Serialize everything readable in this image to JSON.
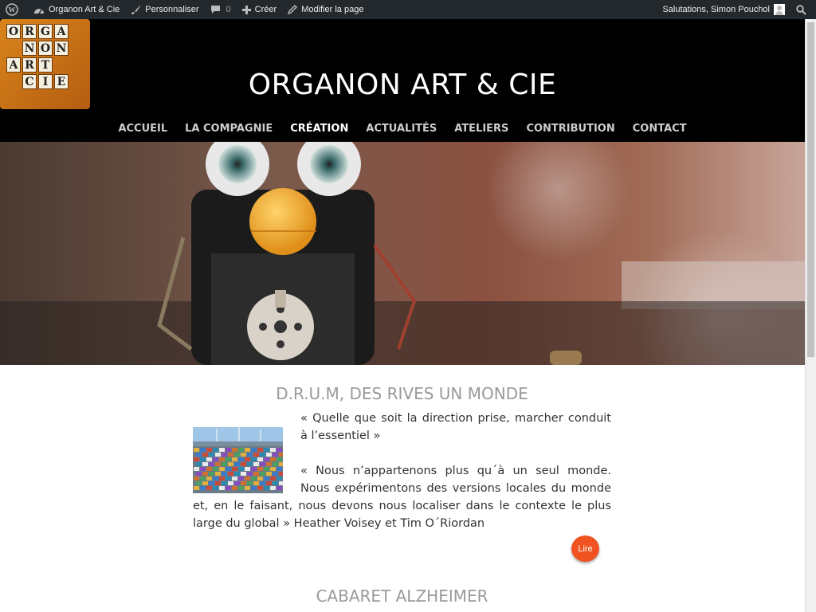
{
  "adminbar": {
    "site_name": "Organon Art & Cie",
    "customize": "Personnaliser",
    "comments_count": "0",
    "create": "Créer",
    "edit_page": "Modifier la page",
    "greeting": "Salutations, Simon Pouchol"
  },
  "header": {
    "logo_letters": [
      [
        "O",
        "R",
        "G",
        "A"
      ],
      [
        "",
        "N",
        "O",
        "N"
      ],
      [
        "A",
        "R",
        "T",
        ""
      ],
      [
        "",
        "C",
        "I",
        "E"
      ]
    ],
    "site_title": "ORGANON ART & CIE"
  },
  "nav": {
    "items": [
      {
        "label": "ACCUEIL"
      },
      {
        "label": "LA COMPAGNIE"
      },
      {
        "label": "CRÉATION"
      },
      {
        "label": "ACTUALITÉS"
      },
      {
        "label": "ATELIERS"
      },
      {
        "label": "CONTRIBUTION"
      },
      {
        "label": "CONTACT"
      }
    ],
    "active": "CRÉATION"
  },
  "posts": [
    {
      "title": "D.R.U.M, DES RIVES UN MONDE",
      "paragraph1": "« Quelle que soit la direction prise, marcher conduit à l’essentiel »",
      "paragraph2": "« Nous n’appartenons plus qu´à un seul monde. Nous expérimentons des versions locales du monde et, en le faisant, nous devons nous localiser dans le contexte le plus large du global » Heather Voisey et Tim O´Riordan",
      "read_more": "Lire"
    },
    {
      "title": "CABARET ALZHEIMER"
    }
  ],
  "colors": {
    "adminbar_bg": "#23282d",
    "header_bg": "#000000",
    "accent_button": "#f0531f",
    "post_title": "#9a9a9a"
  },
  "icons": [
    "wordpress-icon",
    "dashboard-icon",
    "brush-icon",
    "comment-icon",
    "plus-icon",
    "pencil-icon",
    "avatar-icon",
    "search-icon"
  ]
}
